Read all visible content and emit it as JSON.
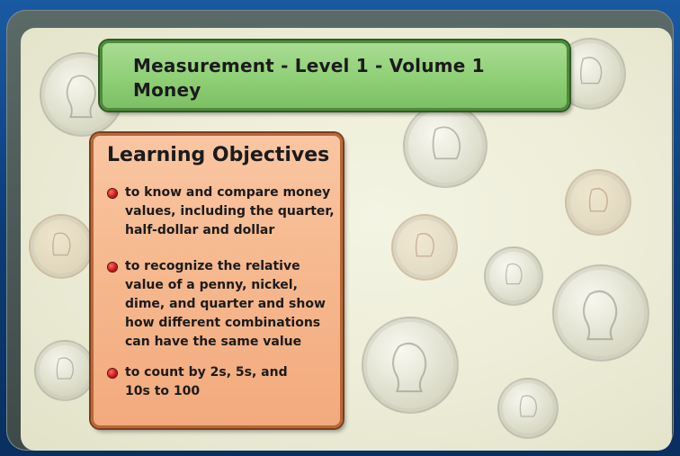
{
  "header": {
    "title_line1": "Measurement - Level 1 - Volume 1",
    "title_line2": "Money"
  },
  "objectives": {
    "heading": "Learning Objectives",
    "items": [
      {
        "lines": [
          "to know and compare money",
          "values, including the quarter,",
          "half-dollar and dollar"
        ]
      },
      {
        "lines": [
          "to recognize the relative",
          "value of a penny, nickel,",
          "dime, and quarter and show",
          "how different combinations",
          "can have the same value"
        ]
      },
      {
        "lines": [
          "to count by 2s, 5s, and",
          "10s to 100"
        ]
      }
    ]
  },
  "colors": {
    "title_green": "#8fcf76",
    "objectives_orange": "#f6b78d",
    "bullet_red": "#c8141a",
    "frame_blue": "#0c3b78"
  }
}
